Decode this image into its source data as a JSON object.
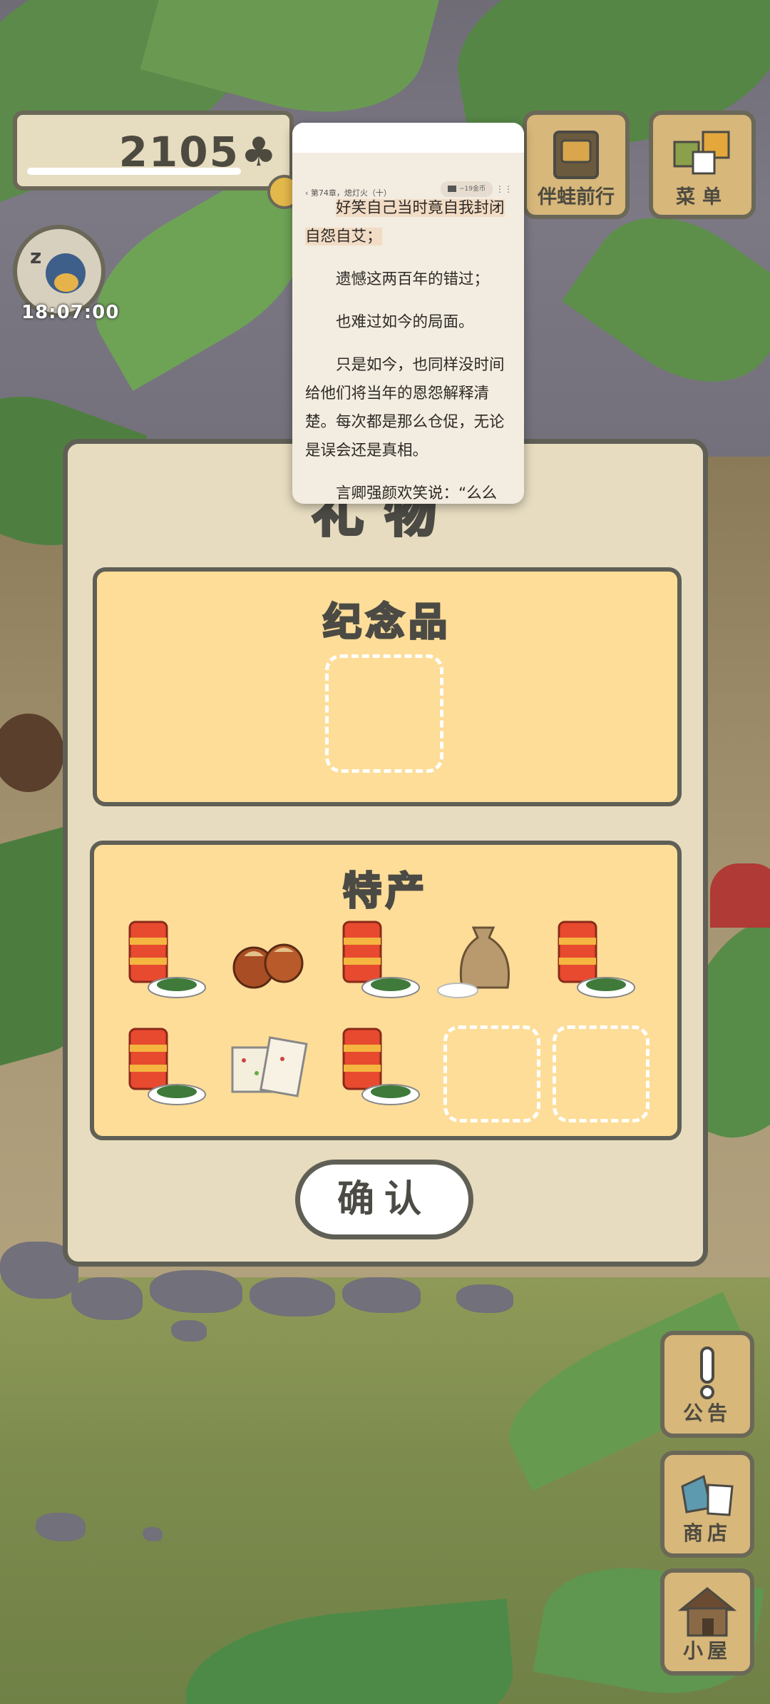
{
  "hud": {
    "clover_count": "2105",
    "clover_symbol": "♣",
    "timer": "18:07:00",
    "companion_label": "伴蛙前行",
    "menu_label": "菜单"
  },
  "side_buttons": {
    "notice_label": "公告",
    "shop_label": "商店",
    "house_label": "小屋"
  },
  "dialog": {
    "title": "礼物",
    "souvenir_title": "纪念品",
    "specialty_title": "特产",
    "confirm_label": "确认",
    "specialty_items": [
      "lantern-and-greens",
      "chestnuts",
      "lantern-and-greens",
      "rice-sack",
      "lantern-and-greens",
      "lantern-and-greens",
      "rice-cake",
      "lantern-and-greens"
    ]
  },
  "reader": {
    "chapter": "‹ 第74章，熄灯火（十）",
    "pill_text": "~19金币",
    "paragraphs": [
      "好笑自己当时竟自我封闭自怨自艾；",
      "遗憾这两百年的错过；",
      "也难过如今的局面。",
      "只是如今，也同样没时间给他们将当年的恩怨解释清楚。每次都是那么仓促，无论是误会还是真相。",
      "言卿强颜欢笑说：“么么"
    ]
  },
  "colors": {
    "panel_bg": "#e7dcc0",
    "section_bg": "#fddd98",
    "outline": "#5f5f55",
    "tile_wood": "#d7b77a"
  }
}
